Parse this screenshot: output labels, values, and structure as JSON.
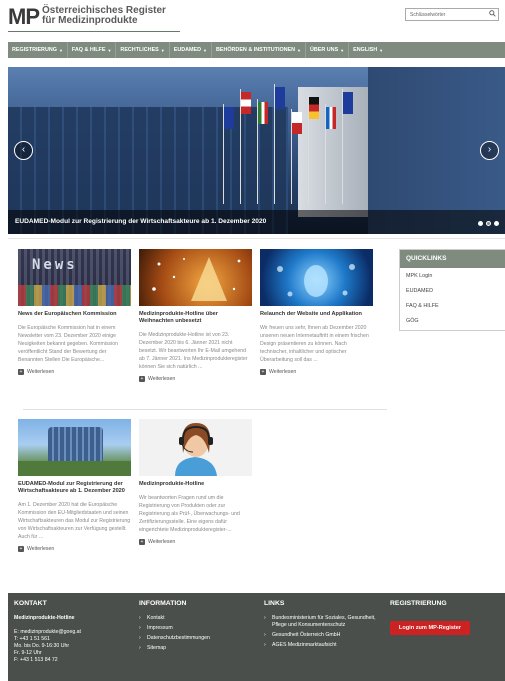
{
  "header": {
    "logo_mark": "MP",
    "logo_line1": "Österreichisches Register",
    "logo_line2": "für Medizinprodukte",
    "search_placeholder": "Schlüsselwörter"
  },
  "nav": [
    {
      "label": "REGISTRIERUNG",
      "caret": "▼"
    },
    {
      "label": "FAQ & HILFE",
      "caret": "▼"
    },
    {
      "label": "RECHTLICHES",
      "caret": "▼"
    },
    {
      "label": "EUDAMED",
      "caret": "▼"
    },
    {
      "label": "BEHÖRDEN & INSTITUTIONEN",
      "caret": "▼"
    },
    {
      "label": "ÜBER UNS",
      "caret": "▼"
    },
    {
      "label": "ENGLISH",
      "caret": "▼"
    }
  ],
  "hero": {
    "caption": "EUDAMED-Modul zur Registrierung der Wirtschaftsakteure ab 1. Dezember 2020",
    "prev": "‹",
    "next": "›"
  },
  "articles": [
    {
      "title": "News der Europäischen Kommission",
      "image_text": "News",
      "text": "Die Europäische Kommission hat in einem Newsletter vom 23. Dezember 2020 einige Neuigkeiten bekannt gegeben. Kommission veröffentlicht Stand der Bewertung der Benannten Stellen Die Europäische...",
      "more": "Weiterlesen"
    },
    {
      "title": "Medizinprodukte-Hotline über Weihnachten unbesetzt",
      "text": "Die Medizinprodukte-Hotline ist von 23. Dezember 2020 bis 6. Jänner 2021 nicht besetzt. Wir beantworten Ihr E-Mail umgehend ab 7. Jänner 2021. Ins Medizinprodukteregister können Sie sich natürlich ...",
      "more": "Weiterlesen"
    },
    {
      "title": "Relaunch der Website und Applikation",
      "text": "Wir freuen uns sehr, Ihnen ab Dezember 2020 unseren neuen Internetauftritt in einem frischen Design präsentieren zu können. Nach technischer, inhaltlicher und optischer Überarbeitung soll das ...",
      "more": "Weiterlesen"
    },
    {
      "title": "EUDAMED-Modul zur Registrierung der Wirtschaftsakteure ab 1. Dezember 2020",
      "text": "Am 1. Dezember 2020 hat die Europäische Kommission den EU-Mitgliedstaaten und seinen Wirtschaftsakteuren das Modul zur Registrierung von Wirtschaftsakteuren zur Verfügung gestellt. Auch für ...",
      "more": "Weiterlesen"
    },
    {
      "title": "Medizinprodukte-Hotline",
      "text": "Wir beantworten Fragen rund um die Registrierung von Produkten oder zur Registrierung als Prüf-, Überwachungs- und Zertifizierungsstelle. Eine eigens dafür eingerichtete Medizinprodukteregister-...",
      "more": "Weiterlesen"
    }
  ],
  "quicklinks": {
    "title": "QUICKLINKS",
    "items": [
      "MPK Login",
      "EUDAMED",
      "FAQ & HILFE",
      "GÖG"
    ]
  },
  "footer": {
    "kontakt": {
      "title": "KONTAKT",
      "name": "Medizinprodukte-Hotline",
      "email": "E: medizinprodukte@goeg.at",
      "phone": "T: +43 1 51 561",
      "hours1": "Mo. bis Do. 9-16:30 Uhr",
      "hours2": "Fr. 9-12 Uhr",
      "fax": "F: +43 1 513 84 72"
    },
    "information": {
      "title": "INFORMATION",
      "links": [
        "Kontakt",
        "Impressum",
        "Datenschutzbestimmungen",
        "Sitemap"
      ]
    },
    "links": {
      "title": "LINKS",
      "items": [
        "Bundesministerium für Soziales, Gesundheit, Pflege und Konsumentenschutz",
        "Gesundheit Österreich GmbH",
        "AGES Medizinmarktaufsicht"
      ]
    },
    "registrierung": {
      "title": "REGISTRIERUNG",
      "button": "Login zum MP-Register"
    }
  },
  "colors": {
    "nav_bg": "#7f8b7f",
    "footer_bg": "#4b4f4b",
    "button_red": "#cc2222"
  }
}
